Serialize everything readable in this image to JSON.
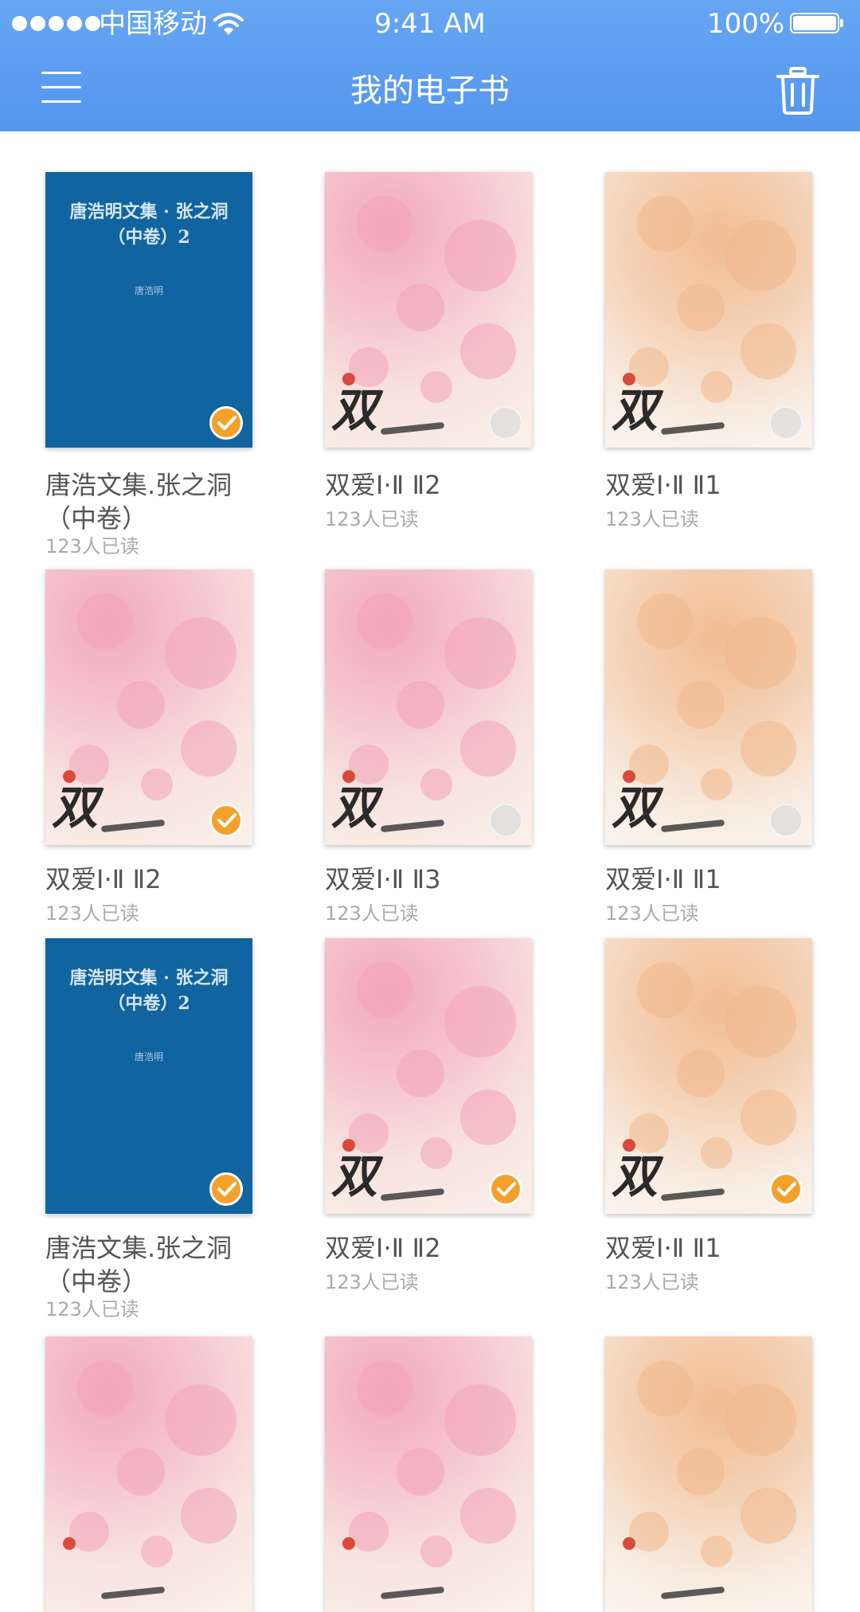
{
  "status_bar": {
    "carrier": "中国移动",
    "time": "9:41 AM",
    "battery": "100%"
  },
  "navbar": {
    "title": "我的电子书",
    "menu_icon": "hamburger-menu-icon",
    "trash_icon": "trash-icon"
  },
  "colors": {
    "header": "#5d9ef1",
    "selected": "#f4a12c"
  },
  "books": [
    {
      "title": "唐浩文集.张之洞\n（中卷）",
      "reads": "123人已读",
      "cover": "blue",
      "cover_title": "唐浩明文集 · 张之洞\n（中卷）2",
      "cover_author": "唐浩明",
      "selected": true
    },
    {
      "title": "双爱Ⅰ·Ⅱ Ⅱ2",
      "reads": "123人已读",
      "cover": "pink",
      "cover_text": "双",
      "selected": false
    },
    {
      "title": "双爱Ⅰ·Ⅱ Ⅱ1",
      "reads": "123人已读",
      "cover": "peach",
      "cover_text": "双",
      "selected": false
    },
    {
      "title": "双爱Ⅰ·Ⅱ Ⅱ2",
      "reads": "123人已读",
      "cover": "pink",
      "cover_text": "双",
      "selected": true
    },
    {
      "title": "双爱Ⅰ·Ⅱ Ⅱ3",
      "reads": "123人已读",
      "cover": "pink",
      "cover_text": "双",
      "selected": false
    },
    {
      "title": "双爱Ⅰ·Ⅱ Ⅱ1",
      "reads": "123人已读",
      "cover": "peach",
      "cover_text": "双",
      "selected": false
    },
    {
      "title": "唐浩文集.张之洞\n（中卷）",
      "reads": "123人已读",
      "cover": "blue",
      "cover_title": "唐浩明文集 · 张之洞\n（中卷）2",
      "cover_author": "唐浩明",
      "selected": true
    },
    {
      "title": "双爱Ⅰ·Ⅱ Ⅱ2",
      "reads": "123人已读",
      "cover": "pink",
      "cover_text": "双",
      "selected": true
    },
    {
      "title": "双爱Ⅰ·Ⅱ Ⅱ1",
      "reads": "123人已读",
      "cover": "peach",
      "cover_text": "双",
      "selected": true
    },
    {
      "title": "",
      "reads": "",
      "cover": "pink"
    },
    {
      "title": "",
      "reads": "",
      "cover": "pink"
    },
    {
      "title": "",
      "reads": "",
      "cover": "peach"
    }
  ]
}
